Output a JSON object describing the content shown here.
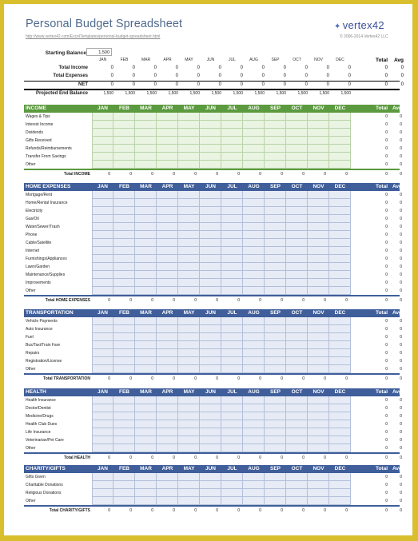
{
  "header": {
    "title": "Personal Budget Spreadsheet",
    "url": "http://www.vertex42.com/ExcelTemplates/personal-budget-spreadsheet.html",
    "logo": "vertex42",
    "copyright": "© 2006-2014 Vertex42 LLC"
  },
  "summary": {
    "starting_balance_label": "Starting Balance",
    "starting_balance": "1,500",
    "months": [
      "JAN",
      "FEB",
      "MAR",
      "APR",
      "MAY",
      "JUN",
      "JUL",
      "AUG",
      "SEP",
      "OCT",
      "NOV",
      "DEC"
    ],
    "total_label": "Total",
    "avg_label": "Avg",
    "rows": [
      {
        "label": "Total Income",
        "values": [
          "0",
          "0",
          "0",
          "0",
          "0",
          "0",
          "0",
          "0",
          "0",
          "0",
          "0",
          "0"
        ],
        "total": "0",
        "avg": "0"
      },
      {
        "label": "Total Expenses",
        "values": [
          "0",
          "0",
          "0",
          "0",
          "0",
          "0",
          "0",
          "0",
          "0",
          "0",
          "0",
          "0"
        ],
        "total": "0",
        "avg": "0"
      },
      {
        "label": "NET",
        "values": [
          "0",
          "0",
          "0",
          "0",
          "0",
          "0",
          "0",
          "0",
          "0",
          "0",
          "0",
          "0"
        ],
        "total": "0",
        "avg": "0"
      },
      {
        "label": "Projected End Balance",
        "values": [
          "1,500",
          "1,500",
          "1,500",
          "1,500",
          "1,500",
          "1,500",
          "1,500",
          "1,500",
          "1,500",
          "1,500",
          "1,500",
          "1,500"
        ],
        "total": "",
        "avg": ""
      }
    ]
  },
  "sections": [
    {
      "key": "income",
      "theme": "green",
      "title": "INCOME",
      "items": [
        "Wages & Tips",
        "Interest Income",
        "Dividends",
        "Gifts Received",
        "Refunds/Reimbursements",
        "Transfer From Savings",
        "Other"
      ],
      "item_total": "0",
      "item_avg": "0",
      "total_label": "Total INCOME",
      "total_value": "0"
    },
    {
      "key": "home",
      "theme": "blue",
      "title": "HOME EXPENSES",
      "items": [
        "Mortgage/Rent",
        "Home/Rental Insurance",
        "Electricity",
        "Gas/Oil",
        "Water/Sewer/Trash",
        "Phone",
        "Cable/Satellite",
        "Internet",
        "Furnishings/Appliances",
        "Lawn/Garden",
        "Maintenance/Supplies",
        "Improvements",
        "Other"
      ],
      "item_total": "0",
      "item_avg": "0",
      "total_label": "Total HOME EXPENSES",
      "total_value": "0"
    },
    {
      "key": "transportation",
      "theme": "blue",
      "title": "TRANSPORTATION",
      "items": [
        "Vehicle Payments",
        "Auto Insurance",
        "Fuel",
        "Bus/Taxi/Train Fare",
        "Repairs",
        "Registration/License",
        "Other"
      ],
      "item_total": "0",
      "item_avg": "0",
      "total_label": "Total TRANSPORTATION",
      "total_value": "0"
    },
    {
      "key": "health",
      "theme": "blue",
      "title": "HEALTH",
      "items": [
        "Health Insurance",
        "Doctor/Dentist",
        "Medicine/Drugs",
        "Health Club Dues",
        "Life Insurance",
        "Veterinarian/Pet Care",
        "Other"
      ],
      "item_total": "0",
      "item_avg": "0",
      "total_label": "Total HEALTH",
      "total_value": "0"
    },
    {
      "key": "charity",
      "theme": "blue",
      "title": "CHARITY/GIFTS",
      "items": [
        "Gifts Given",
        "Charitable Donations",
        "Religious Donations",
        "Other"
      ],
      "item_total": "0",
      "item_avg": "0",
      "total_label": "Total CHARITY/GIFTS",
      "total_value": "0"
    }
  ]
}
